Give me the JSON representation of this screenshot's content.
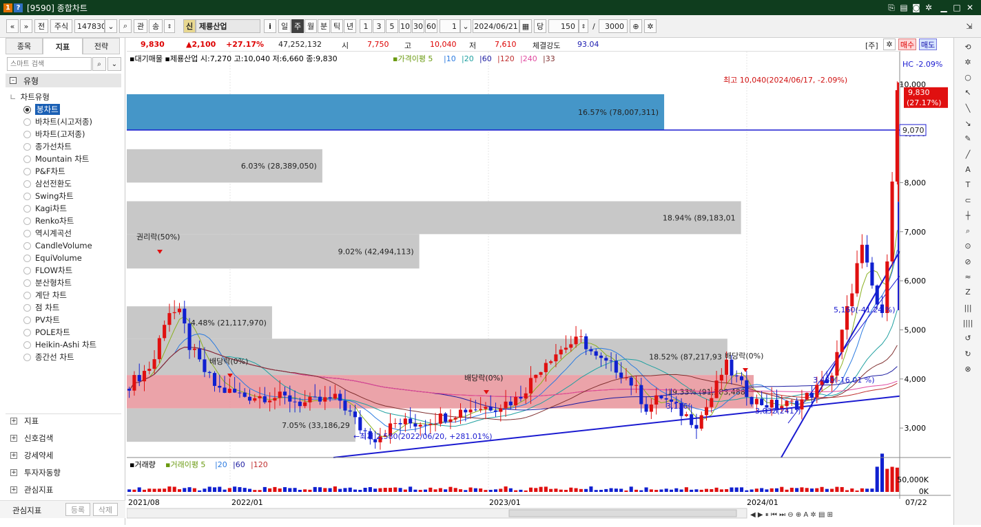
{
  "window": {
    "badge1": "1",
    "badge2": "?",
    "title": "[9590] 종합차트"
  },
  "toolbar": {
    "market": "전",
    "type": "주식",
    "code": "147830",
    "q1": "관",
    "q2": "송",
    "credit_tag": "신",
    "stock_name": "제룡산업",
    "info": "i",
    "periods": [
      "일",
      "주",
      "월",
      "분",
      "틱",
      "년"
    ],
    "active_period": "주",
    "intervals": [
      "1",
      "3",
      "5",
      "10",
      "30",
      "60"
    ],
    "interval_value": "1",
    "date": "2024/06/21",
    "count_label": "당",
    "count": "150",
    "slash": "/",
    "total": "3000"
  },
  "left": {
    "tabs": [
      "종목",
      "지표",
      "전략"
    ],
    "active_tab": "지표",
    "search_placeholder": "스마트 검색",
    "group": "유형",
    "subgroup": "차트유형",
    "chart_types": [
      "봉차트",
      "바차트(시고저종)",
      "바차트(고저종)",
      "종가선차트",
      "Mountain 차트",
      "P&F차트",
      "삼선전환도",
      "Swing차트",
      "Kagi차트",
      "Renko차트",
      "역시계곡선",
      "CandleVolume",
      "EquiVolume",
      "FLOW차트",
      "분산형차트",
      "계단 차트",
      "점 차트",
      "PV차트",
      "POLE차트",
      "Heikin-Ashi 차트",
      "종간선 차트"
    ],
    "sections": [
      "지표",
      "신호검색",
      "강세약세",
      "투자자동향",
      "관심지표"
    ],
    "fav_label": "관심지표",
    "fav_register": "등록",
    "fav_delete": "삭제"
  },
  "quote": {
    "price": "9,830",
    "change": "▲2,100",
    "change_pct": "+27.17%",
    "volume": "47,252,132",
    "open_label": "시",
    "open": "7,750",
    "high_label": "고",
    "high": "10,040",
    "low_label": "저",
    "low": "7,610",
    "strength_label": "체결강도",
    "strength": "93.04",
    "tag": "[주]",
    "buy": "매수",
    "sell": "매도"
  },
  "legend": {
    "main": "▪대기매물 ▪제룡산업 시:7,270 고:10,040 저:6,660 종:9,830",
    "ma_title": "▪가격이평 5",
    "ma_periods": [
      "10",
      "20",
      "60",
      "120",
      "240",
      "33"
    ],
    "ma_colors": [
      "#2a7ae0",
      "#1fa0a0",
      "#1a1aa0",
      "#c03030",
      "#e04aa0",
      "#803030"
    ],
    "hc": "HC  -2.09%",
    "volume_title": "▪거래량",
    "vol_ma_title": "▪거래이평 5",
    "vol_ma_periods": [
      "20",
      "60",
      "120"
    ]
  },
  "chart_data": {
    "type": "candlestick",
    "y_ticks": [
      "10,000",
      "9,000",
      "8,000",
      "7,000",
      "6,000",
      "5,000",
      "4,000",
      "3,000"
    ],
    "y_range": [
      2400,
      10500
    ],
    "x_ticks": [
      "2021/08",
      "2022/01",
      "2023/01",
      "2024/01",
      "07/22"
    ],
    "current_price_label": "9,830",
    "current_pct_label": "(27.17%)",
    "hline_label": "9,070",
    "high_annotation": "최고 10,040(2024/06/17, -2.09%)",
    "low_annotation": "←최저 2,580(2022/06/20, +281.01%)",
    "volume_profile": [
      {
        "label": "16.57% (78,007,311)",
        "pct": 16.57,
        "range": [
          9070,
          9800
        ],
        "color": "blue"
      },
      {
        "label": "18.94% (89,183,01",
        "pct": 18.94,
        "range": [
          6950,
          7620
        ],
        "color": "gray"
      },
      {
        "label": "6.03% (28,389,050)",
        "pct": 6.03,
        "range": [
          8000,
          8680
        ],
        "color": "gray"
      },
      {
        "label": "9.02% (42,494,113)",
        "pct": 9.02,
        "range": [
          6250,
          6950
        ],
        "color": "gray"
      },
      {
        "label": "4.48% (21,117,970)",
        "pct": 4.48,
        "range": [
          4820,
          5480
        ],
        "color": "gray"
      },
      {
        "label": "18.52% (87,217,93",
        "pct": 18.52,
        "range": [
          4080,
          4820
        ],
        "color": "gray"
      },
      {
        "label": "19.33% (91,283,488)",
        "pct": 19.33,
        "range": [
          3400,
          4080
        ],
        "color": "red"
      },
      {
        "label": "7.05% (33,186,29",
        "pct": 7.05,
        "range": [
          2720,
          3400
        ],
        "color": "gray"
      }
    ],
    "annotations": [
      "권리락(50%)",
      "배당락(0%)",
      "배당락(0%)",
      "배당락(0%)",
      "3,136(",
      "3,032(241°)",
      "3,480(-16.01 %)",
      "5,160(-41.24 %)"
    ],
    "volume_axis": [
      "50,000K",
      "0K"
    ]
  }
}
